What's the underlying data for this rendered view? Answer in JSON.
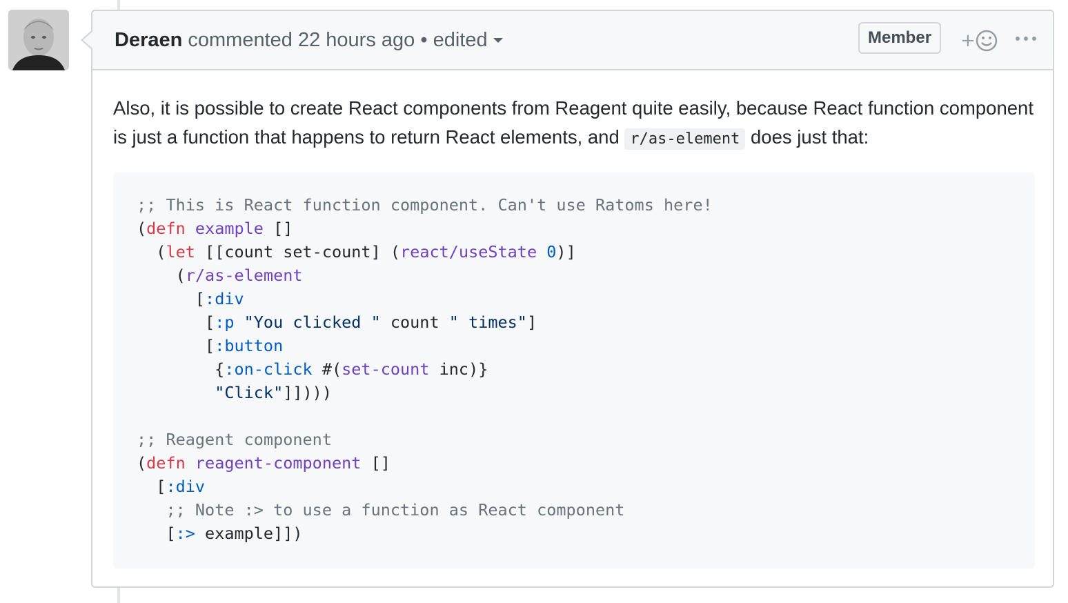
{
  "comment": {
    "author": "Deraen",
    "action": "commented",
    "time": "22 hours ago",
    "separator": "•",
    "edited_label": "edited",
    "role_badge": "Member",
    "reaction_plus": "+",
    "paragraph": {
      "before_code": "Also, it is possible to create React components from Reagent quite easily, because React function component is just a function that happens to return React elements, and",
      "inline_code": "r/as-element",
      "after_code": "does just that:"
    },
    "code_lines": [
      [
        {
          "t": ";; This is React function component. Can't use Ratoms here!",
          "c": "comment"
        }
      ],
      [
        {
          "t": "(",
          "c": "plain"
        },
        {
          "t": "defn",
          "c": "keyword"
        },
        {
          "t": " ",
          "c": "plain"
        },
        {
          "t": "example",
          "c": "entity"
        },
        {
          "t": " []",
          "c": "plain"
        }
      ],
      [
        {
          "t": "  (",
          "c": "plain"
        },
        {
          "t": "let",
          "c": "keyword"
        },
        {
          "t": " [[count set-count] (",
          "c": "plain"
        },
        {
          "t": "react/useState",
          "c": "entity"
        },
        {
          "t": " ",
          "c": "plain"
        },
        {
          "t": "0",
          "c": "constant"
        },
        {
          "t": ")]",
          "c": "plain"
        }
      ],
      [
        {
          "t": "    (",
          "c": "plain"
        },
        {
          "t": "r/as-element",
          "c": "entity"
        }
      ],
      [
        {
          "t": "      [",
          "c": "plain"
        },
        {
          "t": ":div",
          "c": "constant"
        }
      ],
      [
        {
          "t": "       [",
          "c": "plain"
        },
        {
          "t": ":p",
          "c": "constant"
        },
        {
          "t": " ",
          "c": "plain"
        },
        {
          "t": "\"You clicked \"",
          "c": "string"
        },
        {
          "t": " count ",
          "c": "plain"
        },
        {
          "t": "\" times\"",
          "c": "string"
        },
        {
          "t": "]",
          "c": "plain"
        }
      ],
      [
        {
          "t": "       [",
          "c": "plain"
        },
        {
          "t": ":button",
          "c": "constant"
        }
      ],
      [
        {
          "t": "        {",
          "c": "plain"
        },
        {
          "t": ":on-click",
          "c": "constant"
        },
        {
          "t": " #(",
          "c": "plain"
        },
        {
          "t": "set-count",
          "c": "entity"
        },
        {
          "t": " inc)}",
          "c": "plain"
        }
      ],
      [
        {
          "t": "        ",
          "c": "plain"
        },
        {
          "t": "\"Click\"",
          "c": "string"
        },
        {
          "t": "]])))",
          "c": "plain"
        }
      ],
      [
        {
          "t": "",
          "c": "plain"
        }
      ],
      [
        {
          "t": ";; Reagent component",
          "c": "comment"
        }
      ],
      [
        {
          "t": "(",
          "c": "plain"
        },
        {
          "t": "defn",
          "c": "keyword"
        },
        {
          "t": " ",
          "c": "plain"
        },
        {
          "t": "reagent-component",
          "c": "entity"
        },
        {
          "t": " []",
          "c": "plain"
        }
      ],
      [
        {
          "t": "  [",
          "c": "plain"
        },
        {
          "t": ":div",
          "c": "constant"
        }
      ],
      [
        {
          "t": "   ",
          "c": "plain"
        },
        {
          "t": ";; Note :> to use a function as React component",
          "c": "comment"
        }
      ],
      [
        {
          "t": "   [",
          "c": "plain"
        },
        {
          "t": ":>",
          "c": "constant"
        },
        {
          "t": " example]])",
          "c": "plain"
        }
      ]
    ]
  },
  "icons": {
    "avatar": "user-avatar-photo",
    "caret": "chevron-down-icon",
    "reaction": "smiley-icon",
    "more": "kebab-horizontal-icon"
  }
}
